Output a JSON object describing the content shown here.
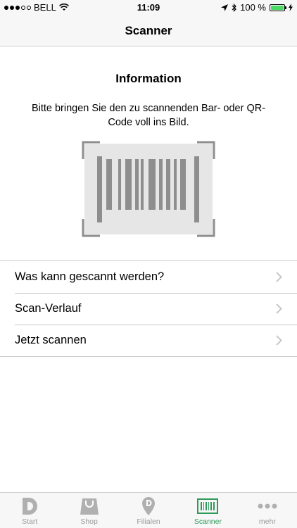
{
  "status_bar": {
    "carrier": "BELL",
    "time": "11:09",
    "battery": "100 %",
    "battery_level": 1.0
  },
  "nav": {
    "title": "Scanner"
  },
  "info": {
    "title": "Information",
    "text": "Bitte bringen Sie den zu scannenden Bar- oder QR-Code voll ins Bild."
  },
  "list": {
    "items": [
      {
        "label": "Was kann gescannt werden?"
      },
      {
        "label": "Scan-Verlauf"
      },
      {
        "label": "Jetzt scannen"
      }
    ]
  },
  "tabs": {
    "start": "Start",
    "shop": "Shop",
    "filialen": "Filialen",
    "scanner": "Scanner",
    "mehr": "mehr",
    "active": "scanner"
  },
  "colors": {
    "accent": "#2d9a5a",
    "inactive": "#999999",
    "bar_background": "#f7f7f7"
  }
}
